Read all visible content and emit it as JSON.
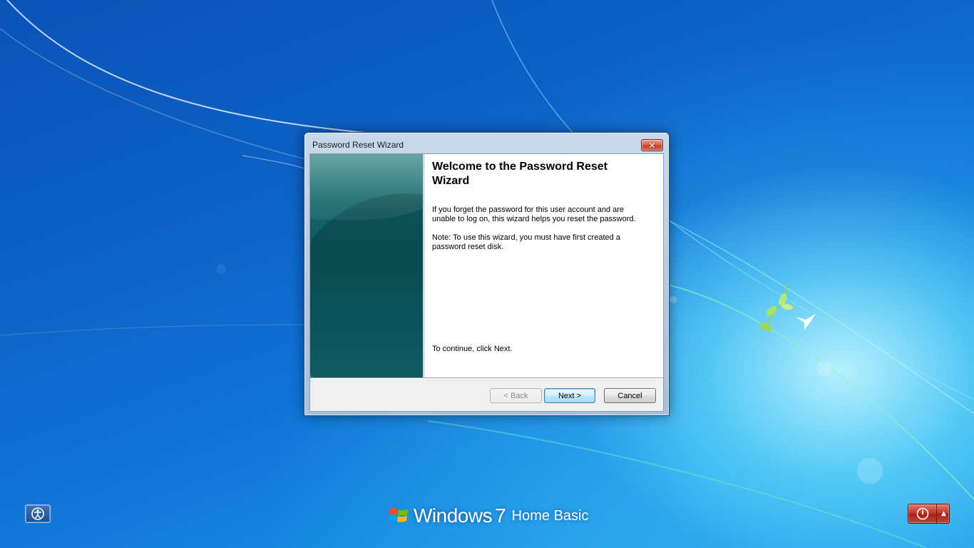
{
  "desktop": {
    "brand": {
      "windows_word": "Windows",
      "version": "7",
      "edition": "Home Basic"
    }
  },
  "dialog": {
    "title": "Password Reset Wizard",
    "heading": "Welcome to the Password Reset Wizard",
    "paragraph1": "If you forget the password for this user account and are unable to log on, this wizard helps you reset the password.",
    "paragraph2": "Note: To use this wizard, you must have first created a password reset disk.",
    "continue_text": "To continue, click Next.",
    "buttons": {
      "back": "< Back",
      "next": "Next >",
      "cancel": "Cancel"
    }
  },
  "icons": {
    "close": "close-icon",
    "ease_of_access": "ease-of-access-icon",
    "shutdown": "power-icon",
    "shutdown_options": "arrow-up-icon",
    "windows_flag": "windows-flag-icon",
    "bird": "bird-icon"
  },
  "colors": {
    "desktop_blue": "#0d63c6",
    "side_panel_teal": "#0d5a5f",
    "close_red": "#c4402a",
    "shutdown_red": "#a81e17",
    "default_button_border": "#3c7fb1"
  }
}
